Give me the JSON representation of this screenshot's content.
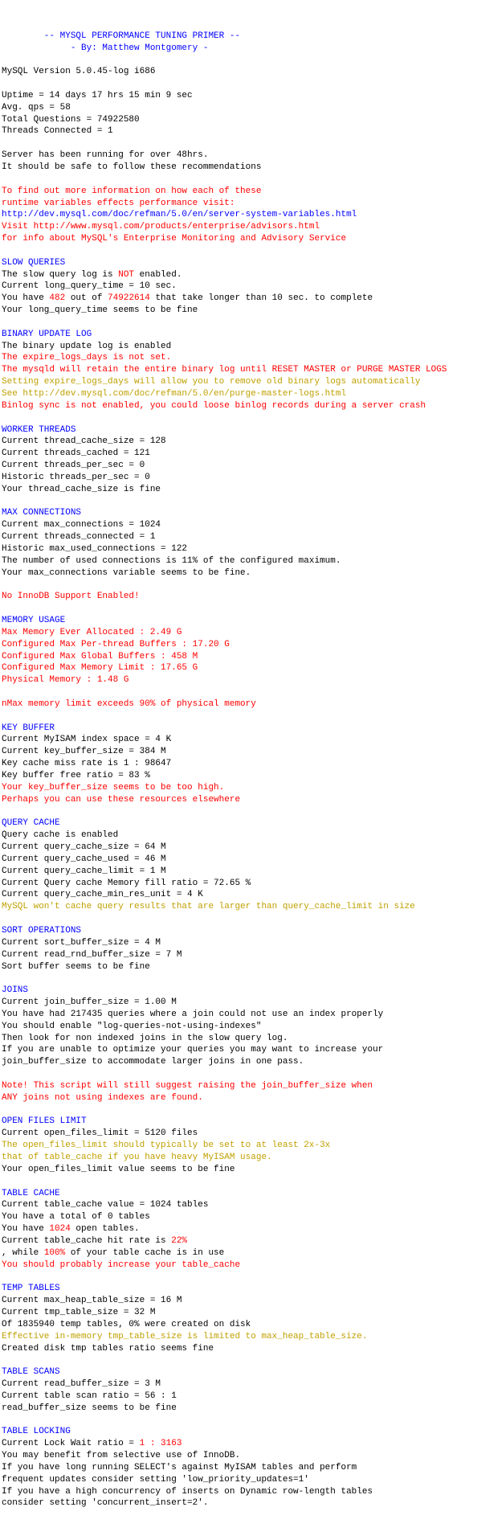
{
  "title_line": "        -- MYSQL PERFORMANCE TUNING PRIMER --",
  "byline": "             - By: Matthew Montgomery -",
  "version": "MySQL Version 5.0.45-log i686",
  "uptime": "Uptime = 14 days 17 hrs 15 min 9 sec",
  "avg_qps": "Avg. qps = 58",
  "total_q": "Total Questions = 74922580",
  "threads_c": "Threads Connected = 1",
  "run48a": "Server has been running for over 48hrs.",
  "run48b": "It should be safe to follow these recommendations",
  "more_a": "To find out more information on how each of these",
  "more_b": "runtime variables effects performance visit:",
  "more_c": "http://dev.mysql.com/doc/refman/5.0/en/server-system-variables.html",
  "more_d": "Visit http://www.mysql.com/products/enterprise/advisors.html",
  "more_e": "for info about MySQL's Enterprise Monitoring and Advisory Service",
  "sq_h": "SLOW QUERIES",
  "sq_a1": "The slow query log is ",
  "sq_a2": "NOT",
  "sq_a3": " enabled.",
  "sq_b": "Current long_query_time = 10 sec.",
  "sq_c1": "You have ",
  "sq_c2": "482",
  "sq_c3": " out of ",
  "sq_c4": "74922614",
  "sq_c5": " that take longer than 10 sec. to complete",
  "sq_d": "Your long_query_time seems to be fine",
  "bu_h": "BINARY UPDATE LOG",
  "bu_a": "The binary update log is enabled",
  "bu_b": "The expire_logs_days is not set.",
  "bu_c": "The mysqld will retain the entire binary log until RESET MASTER or PURGE MASTER LOGS",
  "bu_d": "Setting expire_logs_days will allow you to remove old binary logs automatically",
  "bu_e": "See http://dev.mysql.com/doc/refman/5.0/en/purge-master-logs.html",
  "bu_f": "Binlog sync is not enabled, you could loose binlog records during a server crash",
  "wt_h": "WORKER THREADS",
  "wt_a": "Current thread_cache_size = 128",
  "wt_b": "Current threads_cached = 121",
  "wt_c": "Current threads_per_sec = 0",
  "wt_d": "Historic threads_per_sec = 0",
  "wt_e": "Your thread_cache_size is fine",
  "mc_h": "MAX CONNECTIONS",
  "mc_a": "Current max_connections = 1024",
  "mc_b": "Current threads_connected = 1",
  "mc_c": "Historic max_used_connections = 122",
  "mc_d": "The number of used connections is 11% of the configured maximum.",
  "mc_e": "Your max_connections variable seems to be fine.",
  "no_innodb": "No InnoDB Support Enabled!",
  "mu_h": "MEMORY USAGE",
  "mu_a": "Max Memory Ever Allocated : 2.49 G",
  "mu_b": "Configured Max Per-thread Buffers : 17.20 G",
  "mu_c": "Configured Max Global Buffers : 458 M",
  "mu_d": "Configured Max Memory Limit : 17.65 G",
  "mu_e": "Physical Memory : 1.48 G",
  "mu_f": "nMax memory limit exceeds 90% of physical memory",
  "kb_h": "KEY BUFFER",
  "kb_a": "Current MyISAM index space = 4 K",
  "kb_b": "Current key_buffer_size = 384 M",
  "kb_c": "Key cache miss rate is 1 : 98647",
  "kb_d": "Key buffer free ratio = 83 %",
  "kb_e": "Your key_buffer_size seems to be too high.",
  "kb_f": "Perhaps you can use these resources elsewhere",
  "qc_h": "QUERY CACHE",
  "qc_a": "Query cache is enabled",
  "qc_b": "Current query_cache_size = 64 M",
  "qc_c": "Current query_cache_used = 46 M",
  "qc_d": "Current query_cache_limit = 1 M",
  "qc_e": "Current Query cache Memory fill ratio = 72.65 %",
  "qc_f": "Current query_cache_min_res_unit = 4 K",
  "qc_g": "MySQL won't cache query results that are larger than query_cache_limit in size",
  "so_h": "SORT OPERATIONS",
  "so_a": "Current sort_buffer_size = 4 M",
  "so_b": "Current read_rnd_buffer_size = 7 M",
  "so_c": "Sort buffer seems to be fine",
  "jn_h": "JOINS",
  "jn_a": "Current join_buffer_size = 1.00 M",
  "jn_b": "You have had 217435 queries where a join could not use an index properly",
  "jn_c": "You should enable \"log-queries-not-using-indexes\"",
  "jn_d": "Then look for non indexed joins in the slow query log.",
  "jn_e": "If you are unable to optimize your queries you may want to increase your",
  "jn_f": "join_buffer_size to accommodate larger joins in one pass.",
  "jn_g": "Note! This script will still suggest raising the join_buffer_size when",
  "jn_h2": "ANY joins not using indexes are found.",
  "of_h": "OPEN FILES LIMIT",
  "of_a": "Current open_files_limit = 5120 files",
  "of_b": "The open_files_limit should typically be set to at least 2x-3x",
  "of_c": "that of table_cache if you have heavy MyISAM usage.",
  "of_d": "Your open_files_limit value seems to be fine",
  "tc_h": "TABLE CACHE",
  "tc_a": "Current table_cache value = 1024 tables",
  "tc_b": "You have a total of 0 tables",
  "tc_c1": "You have ",
  "tc_c2": "1024",
  "tc_c3": " open tables.",
  "tc_d1": "Current table_cache hit rate is ",
  "tc_d2": "22%",
  "tc_e1": ", while ",
  "tc_e2": "100%",
  "tc_e3": " of your table cache is in use",
  "tc_f": "You should probably increase your table_cache",
  "tt_h": "TEMP TABLES",
  "tt_a": "Current max_heap_table_size = 16 M",
  "tt_b": "Current tmp_table_size = 32 M",
  "tt_c": "Of 1835940 temp tables, 0% were created on disk",
  "tt_d": "Effective in-memory tmp_table_size is limited to max_heap_table_size.",
  "tt_e": "Created disk tmp tables ratio seems fine",
  "ts_h": "TABLE SCANS",
  "ts_a": "Current read_buffer_size = 3 M",
  "ts_b": "Current table scan ratio = 56 : 1",
  "ts_c": "read_buffer_size seems to be fine",
  "tl_h": "TABLE LOCKING",
  "tl_a1": "Current Lock Wait ratio = ",
  "tl_a2": "1 : 3163",
  "tl_b": "You may benefit from selective use of InnoDB.",
  "tl_c": "If you have long running SELECT's against MyISAM tables and perform",
  "tl_d": "frequent updates consider setting 'low_priority_updates=1'",
  "tl_e": "If you have a high concurrency of inserts on Dynamic row-length tables",
  "tl_f": "consider setting 'concurrent_insert=2'."
}
